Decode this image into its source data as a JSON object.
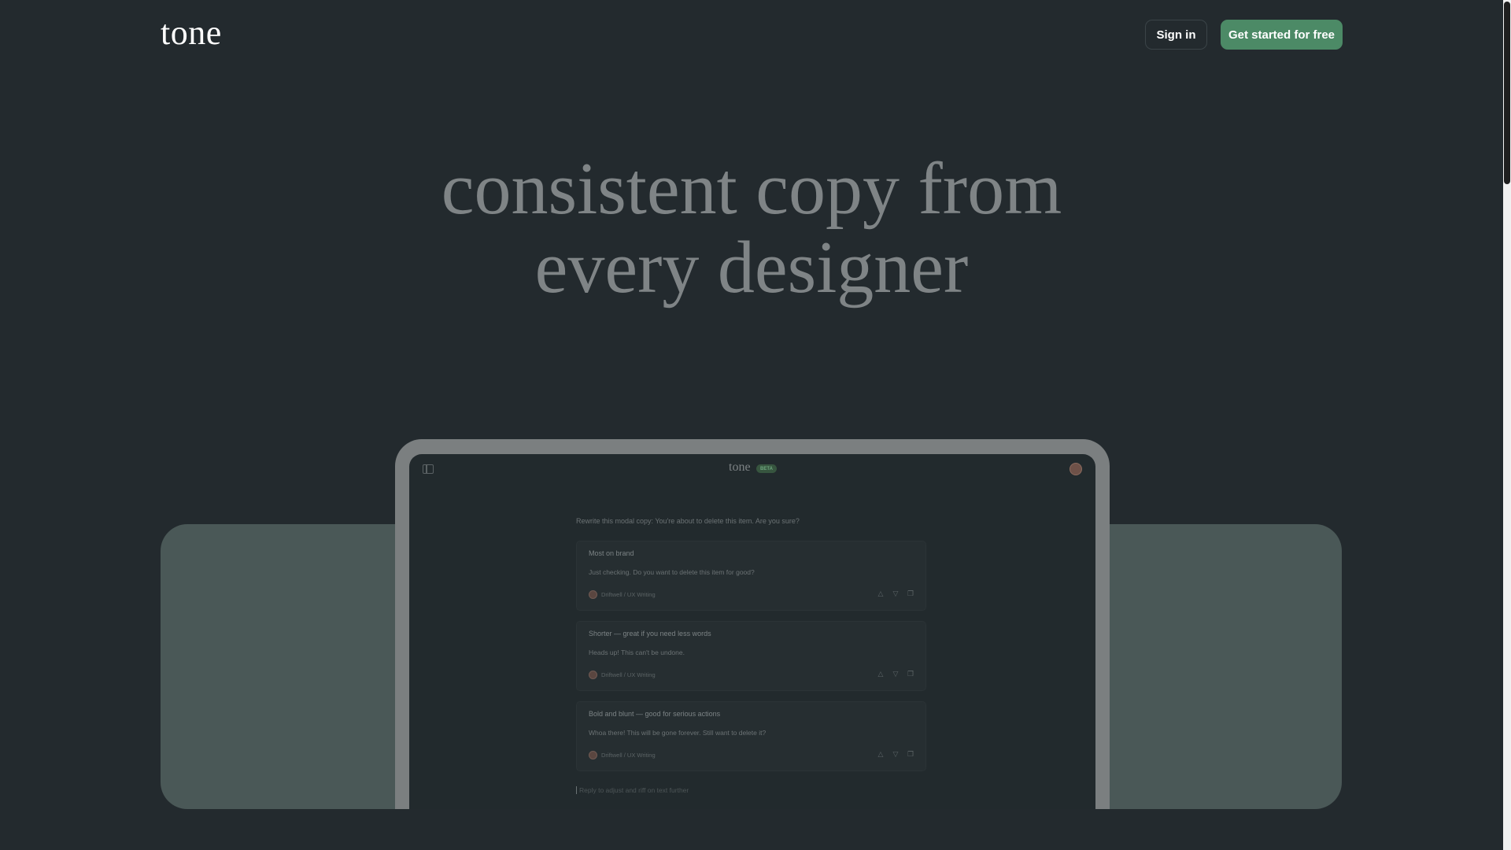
{
  "nav": {
    "logo": "tone",
    "signin_label": "Sign in",
    "start_label": "Get started for free"
  },
  "hero": {
    "line1": "consistent copy from",
    "line2": "every designer"
  },
  "app": {
    "logo": "tone",
    "badge": "BETA",
    "prompt": "Rewrite this modal copy: You're about to delete this item. Are you sure?",
    "cards": [
      {
        "title": "Most on brand",
        "body": "Just checking. Do you want to delete this item for good?",
        "source": "Driftwell / UX Writing"
      },
      {
        "title": "Shorter — great if you need less words",
        "body": "Heads up! This can't be undone.",
        "source": "Driftwell / UX Writing"
      },
      {
        "title": "Bold and blunt — good for serious actions",
        "body": "Whoa there! This will be gone forever. Still want to delete it?",
        "source": "Driftwell / UX Writing"
      }
    ],
    "reply_placeholder": "Reply to adjust and riff on text further"
  },
  "icons": {
    "thumbs_up": "thumbs-up-icon",
    "thumbs_down": "thumbs-down-icon",
    "copy": "copy-icon"
  },
  "colors": {
    "background": "#232a2e",
    "accent": "#4c8a66",
    "band": "#4a5857"
  }
}
